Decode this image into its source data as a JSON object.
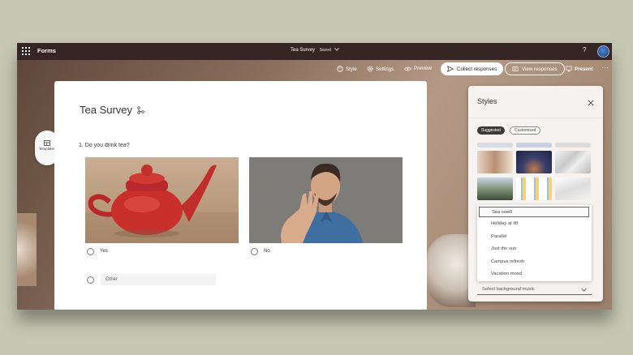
{
  "app": {
    "name": "Forms",
    "doc_title": "Tea Survey",
    "save_status": "Saved"
  },
  "toolbar": {
    "style_label": "Style",
    "settings_label": "Settings",
    "preview_label": "Preview",
    "collect_label": "Collect responses",
    "view_label": "View responses",
    "present_label": "Present"
  },
  "sidepanel": {
    "templates_label": "Templates"
  },
  "form": {
    "title": "Tea Survey",
    "question": "1. Do you drink tea?",
    "options": [
      {
        "label": "Yes",
        "image": "red-teapot"
      },
      {
        "label": "No",
        "image": "man-refusing"
      }
    ],
    "other_placeholder": "Other"
  },
  "styles": {
    "title": "Styles",
    "tabs": [
      "Suggested",
      "Customised"
    ],
    "active_tab": "Suggested",
    "music_options": [
      "Sea swell",
      "Holiday at lift",
      "Parallel",
      "Just the sun",
      "Campus refresh",
      "Vacation mood"
    ],
    "selected_music": "Sea swell",
    "music_placeholder": "Select background music"
  },
  "colors": {
    "topbar": "#352625",
    "chip_active": "#3b3a39",
    "card": "#ffffff",
    "teapot": "#c9302c"
  }
}
